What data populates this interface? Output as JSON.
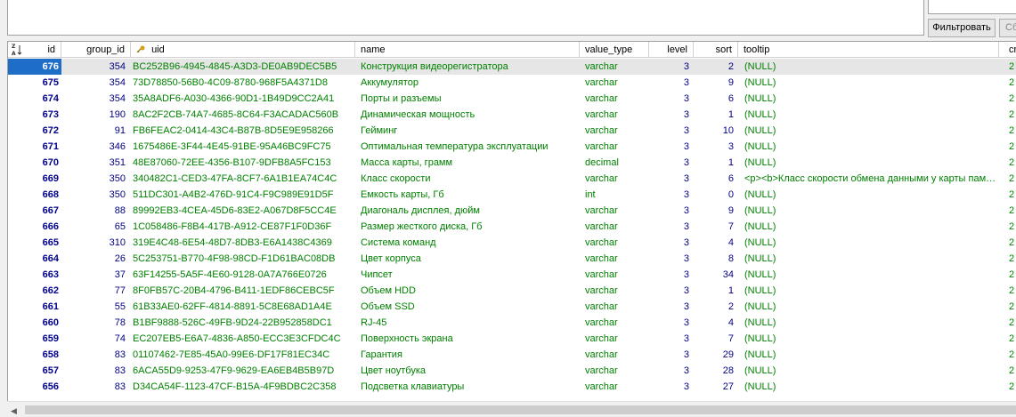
{
  "filter": {
    "button_label": "Фильтровать",
    "clear_label": "Сбросить"
  },
  "icons": {
    "sort": "sort-az-icon",
    "key": "key-icon",
    "scroll_left": "arrow-left-icon"
  },
  "colors": {
    "selection": "#1e6ec8",
    "text_green": "#008000",
    "text_navy": "#000080",
    "row_highlight": "#e6e6e6"
  },
  "columns": [
    "id",
    "group_id",
    "uid",
    "name",
    "value_type",
    "level",
    "sort",
    "tooltip",
    "cr"
  ],
  "rows": [
    {
      "id": "676",
      "group_id": "354",
      "uid": "BC252B96-4945-4845-A3D3-DE0AB9DEC5B5",
      "name": "Конструкция видеорегистратора",
      "value_type": "varchar",
      "level": "3",
      "sort": "2",
      "tooltip": "(NULL)",
      "extra": "2",
      "selected": true
    },
    {
      "id": "675",
      "group_id": "354",
      "uid": "73D78850-56B0-4C09-8780-968F5A4371D8",
      "name": "Аккумулятор",
      "value_type": "varchar",
      "level": "3",
      "sort": "9",
      "tooltip": "(NULL)",
      "extra": "2"
    },
    {
      "id": "674",
      "group_id": "354",
      "uid": "35A8ADF6-A030-4366-90D1-1B49D9CC2A41",
      "name": "Порты и разъемы",
      "value_type": "varchar",
      "level": "3",
      "sort": "6",
      "tooltip": "(NULL)",
      "extra": "2"
    },
    {
      "id": "673",
      "group_id": "190",
      "uid": "8AC2F2CB-74A7-4685-8C64-F3ACADAC560B",
      "name": "Динамическая мощность",
      "value_type": "varchar",
      "level": "3",
      "sort": "1",
      "tooltip": "(NULL)",
      "extra": "2"
    },
    {
      "id": "672",
      "group_id": "91",
      "uid": "FB6FEAC2-0414-43C4-B87B-8D5E9E958266",
      "name": "Гейминг",
      "value_type": "varchar",
      "level": "3",
      "sort": "10",
      "tooltip": "(NULL)",
      "extra": "2"
    },
    {
      "id": "671",
      "group_id": "346",
      "uid": "1675486E-3F44-4E45-91BE-95A46BC9FC75",
      "name": "Оптимальная температура эксплуатации",
      "value_type": "varchar",
      "level": "3",
      "sort": "3",
      "tooltip": "(NULL)",
      "extra": "2"
    },
    {
      "id": "670",
      "group_id": "351",
      "uid": "48E87060-72EE-4356-B107-9DFB8A5FC153",
      "name": "Масса карты, грамм",
      "value_type": "decimal",
      "level": "3",
      "sort": "1",
      "tooltip": "(NULL)",
      "extra": "2"
    },
    {
      "id": "669",
      "group_id": "350",
      "uid": "340482C1-CED3-47FA-8CF7-6A1B1EA74C4C",
      "name": "Класс скорости",
      "value_type": "varchar",
      "level": "3",
      "sort": "6",
      "tooltip": "<p><b>Класс скорости обмена данными у карты памяти",
      "extra": "2"
    },
    {
      "id": "668",
      "group_id": "350",
      "uid": "511DC301-A4B2-476D-91C4-F9C989E91D5F",
      "name": "Емкость карты, Гб",
      "value_type": "int",
      "level": "3",
      "sort": "0",
      "tooltip": "(NULL)",
      "extra": "2"
    },
    {
      "id": "667",
      "group_id": "88",
      "uid": "89992EB3-4CEA-45D6-83E2-A067D8F5CC4E",
      "name": " Диагональ дисплея, дюйм",
      "value_type": "varchar",
      "level": "3",
      "sort": "9",
      "tooltip": "(NULL)",
      "extra": "2"
    },
    {
      "id": "666",
      "group_id": "65",
      "uid": "1C058486-F8B4-417B-A912-CE87F1F0D36F",
      "name": "Размер жесткого диска,  Гб",
      "value_type": "varchar",
      "level": "3",
      "sort": "7",
      "tooltip": "(NULL)",
      "extra": "2"
    },
    {
      "id": "665",
      "group_id": "310",
      "uid": "319E4C48-6E54-48D7-8DB3-E6A1438C4369",
      "name": "Система команд",
      "value_type": "varchar",
      "level": "3",
      "sort": "4",
      "tooltip": "(NULL)",
      "extra": "2"
    },
    {
      "id": "664",
      "group_id": "26",
      "uid": "5C253751-B770-4F98-98CD-F1D61BAC08DB",
      "name": "Цвет  корпуса",
      "value_type": "varchar",
      "level": "3",
      "sort": "8",
      "tooltip": "(NULL)",
      "extra": "2"
    },
    {
      "id": "663",
      "group_id": "37",
      "uid": "63F14255-5A5F-4E60-9128-0A7A766E0726",
      "name": "Чипсет",
      "value_type": "varchar",
      "level": "3",
      "sort": "34",
      "tooltip": "(NULL)",
      "extra": "2"
    },
    {
      "id": "662",
      "group_id": "77",
      "uid": "8F0FB57C-20B4-4796-B411-1EDF86CEBC5F",
      "name": "Объем HDD",
      "value_type": "varchar",
      "level": "3",
      "sort": "1",
      "tooltip": "(NULL)",
      "extra": "2"
    },
    {
      "id": "661",
      "group_id": "55",
      "uid": "61B33AE0-62FF-4814-8891-5C8E68AD1A4E",
      "name": "Объем SSD",
      "value_type": "varchar",
      "level": "3",
      "sort": "2",
      "tooltip": "(NULL)",
      "extra": "2"
    },
    {
      "id": "660",
      "group_id": "78",
      "uid": "B1BF9888-526C-49FB-9D24-22B952858DC1",
      "name": "RJ-45",
      "value_type": "varchar",
      "level": "3",
      "sort": "4",
      "tooltip": "(NULL)",
      "extra": "2"
    },
    {
      "id": "659",
      "group_id": "74",
      "uid": "EC207EB5-E6A7-4836-A850-ECC3E3CFDC4C",
      "name": "Поверхность экрана",
      "value_type": "varchar",
      "level": "3",
      "sort": "7",
      "tooltip": "(NULL)",
      "extra": "2"
    },
    {
      "id": "658",
      "group_id": "83",
      "uid": "01107462-7E85-45A0-99E6-DF17F81EC34C",
      "name": "Гарантия",
      "value_type": "varchar",
      "level": "3",
      "sort": "29",
      "tooltip": "(NULL)",
      "extra": "2"
    },
    {
      "id": "657",
      "group_id": "83",
      "uid": "6ACA55D9-9253-47F9-9629-EA6EB4B5B97D",
      "name": "Цвет ноутбука",
      "value_type": "varchar",
      "level": "3",
      "sort": "28",
      "tooltip": "(NULL)",
      "extra": "2"
    },
    {
      "id": "656",
      "group_id": "83",
      "uid": "D34CA54F-1123-47CF-B15A-4F9BDBC2C358",
      "name": "Подсветка клавиатуры",
      "value_type": "varchar",
      "level": "3",
      "sort": "27",
      "tooltip": "(NULL)",
      "extra": "2"
    }
  ]
}
